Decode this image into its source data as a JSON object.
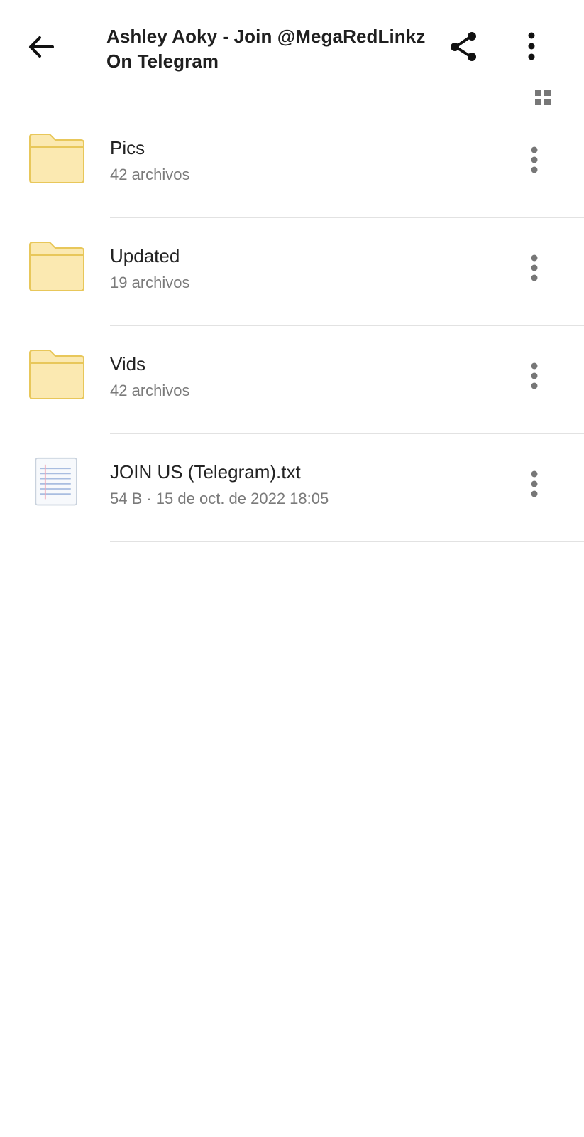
{
  "header": {
    "title": "Ashley Aoky - Join @MegaRedLinkz On Telegram",
    "icons": {
      "back": "arrow-left-icon",
      "share": "share-icon",
      "more": "more-vert-icon",
      "view": "grid-view-icon"
    }
  },
  "items": [
    {
      "type": "folder",
      "name": "Pics",
      "meta": "42 archivos"
    },
    {
      "type": "folder",
      "name": "Updated",
      "meta": "19 archivos"
    },
    {
      "type": "folder",
      "name": "Vids",
      "meta": "42 archivos"
    },
    {
      "type": "text-file",
      "name": "JOIN US (Telegram).txt",
      "meta": "54 B · 15 de oct. de 2022 18:05"
    }
  ],
  "colors": {
    "folder_fill": "#fbe9b1",
    "folder_stroke": "#e8c75a",
    "icon_dark": "#111111",
    "icon_grey": "#777777",
    "divider": "#e2e2e2"
  }
}
